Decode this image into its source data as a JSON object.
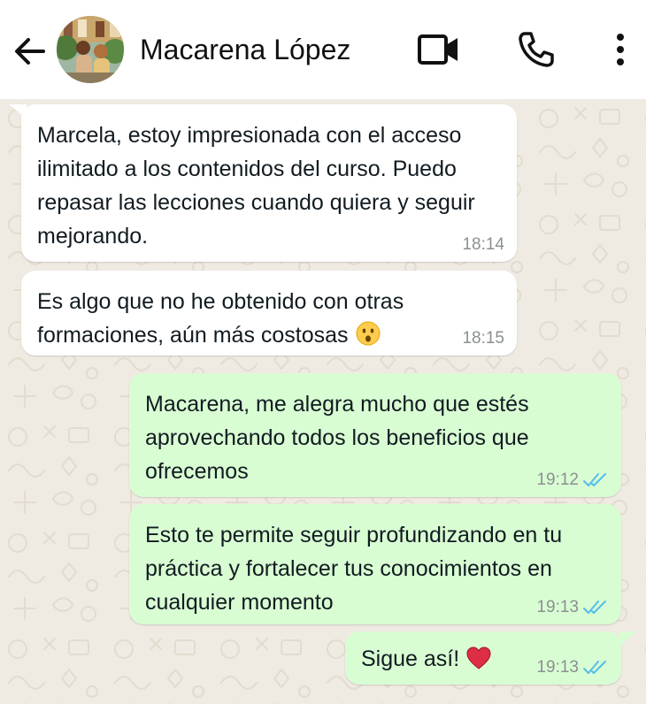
{
  "header": {
    "contact_name": "Macarena López",
    "icons": {
      "back": "arrow-left-icon",
      "video": "video-camera-icon",
      "phone": "phone-icon",
      "more": "vertical-dots-icon"
    }
  },
  "colors": {
    "incoming_bubble": "#ffffff",
    "outgoing_bubble": "#d9fdd3",
    "chat_background": "#efeae2",
    "read_ticks": "#53bdeb"
  },
  "messages": [
    {
      "direction": "incoming",
      "text": "Marcela, estoy impresionada con el acceso ilimitado a los contenidos del curso. Puedo repasar las lecciones cuando quiera y seguir mejorando.",
      "time": "18:14"
    },
    {
      "direction": "incoming",
      "text": "Es algo que no he obtenido con otras formaciones, aún más costosas",
      "emoji": "hushed-face",
      "time": "18:15"
    },
    {
      "direction": "outgoing",
      "text": "Macarena, me alegra mucho que estés aprovechando todos los beneficios que ofrecemos",
      "time": "19:12",
      "status": "read"
    },
    {
      "direction": "outgoing",
      "text": "Esto te permite seguir profundizando en tu práctica y fortalecer tus conocimientos en cualquier momento",
      "time": "19:13",
      "status": "read"
    },
    {
      "direction": "outgoing",
      "text": "Sigue así!",
      "emoji": "red-heart",
      "time": "19:13",
      "status": "read"
    }
  ]
}
